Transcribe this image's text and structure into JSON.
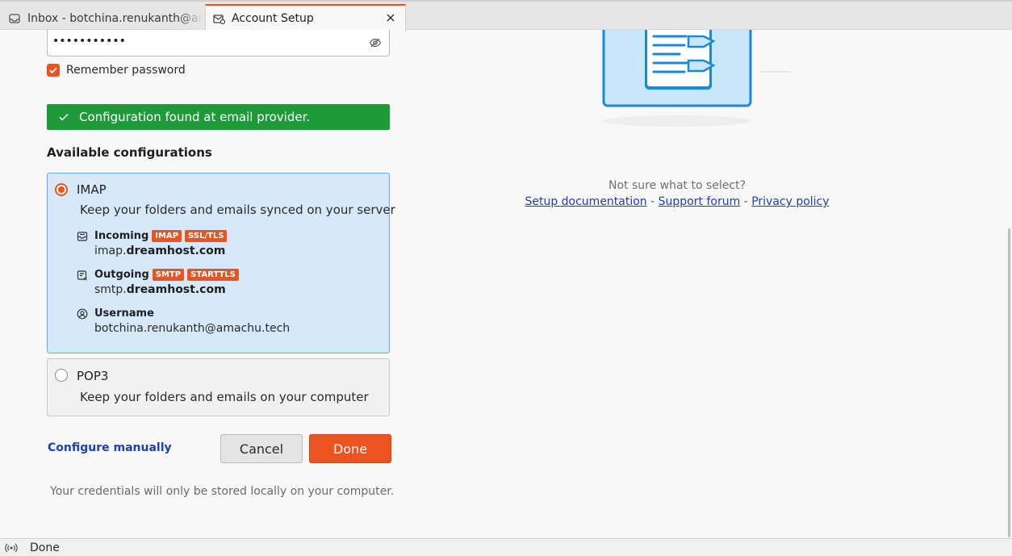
{
  "tabs": [
    {
      "label": "Inbox - botchina.renukanth@am",
      "icon": "mail-inbox-icon",
      "active": false
    },
    {
      "label": "Account Setup",
      "icon": "mail-setup-icon",
      "active": true
    }
  ],
  "password": {
    "masked_value": "•••••••••••",
    "toggle_icon": "eye-hidden-icon"
  },
  "remember_password": {
    "label": "Remember password",
    "checked": true
  },
  "status_message": "Configuration found at email provider.",
  "available_title": "Available configurations",
  "configs": {
    "imap": {
      "name": "IMAP",
      "description": "Keep your folders and emails synced on your server",
      "selected": true,
      "incoming": {
        "label": "Incoming",
        "badges": [
          "IMAP",
          "SSL/TLS"
        ],
        "host_prefix": "imap.",
        "host_domain": "dreamhost.com"
      },
      "outgoing": {
        "label": "Outgoing",
        "badges": [
          "SMTP",
          "STARTTLS"
        ],
        "host_prefix": "smtp.",
        "host_domain": "dreamhost.com"
      },
      "username": {
        "label": "Username",
        "value": "botchina.renukanth@amachu.tech"
      }
    },
    "pop3": {
      "name": "POP3",
      "description": "Keep your folders and emails on your computer",
      "selected": false
    }
  },
  "actions": {
    "configure_manually": "Configure manually",
    "cancel": "Cancel",
    "done": "Done"
  },
  "credentials_note": "Your credentials will only be stored locally on your computer.",
  "help": {
    "question": "Not sure what to select?",
    "links": [
      "Setup documentation",
      "Support forum",
      "Privacy policy"
    ],
    "separator": "-"
  },
  "statusbar": {
    "text": "Done",
    "icon": "activity-icon"
  },
  "colors": {
    "accent": "#e95420",
    "success": "#1f9a3a",
    "selected_bg": "#d6e8fa",
    "link": "#1e40b0"
  }
}
